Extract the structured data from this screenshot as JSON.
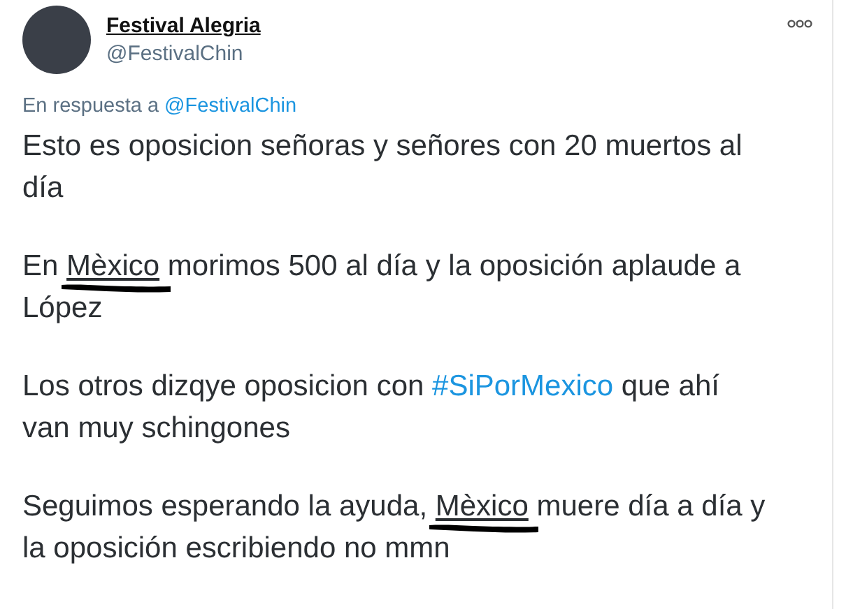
{
  "tweet": {
    "author": {
      "name": "Festival Alegria",
      "handle": "@FestivalChin"
    },
    "reply_to": {
      "label": "En respuesta a",
      "handle": "@FestivalChin"
    },
    "paragraphs": [
      [
        {
          "kind": "text",
          "text": "Esto es oposicion señoras y señores con 20 muertos al día"
        }
      ],
      [
        {
          "kind": "text",
          "text": "En "
        },
        {
          "kind": "marked",
          "text": "Mèxico"
        },
        {
          "kind": "text",
          "text": " morimos 500 al día y la oposición aplaude a López"
        }
      ],
      [
        {
          "kind": "text",
          "text": "Los otros dizqye oposicion con "
        },
        {
          "kind": "hashtag",
          "text": "#SiPorMexico"
        },
        {
          "kind": "text",
          "text": " que ahí van muy schingones"
        }
      ],
      [
        {
          "kind": "text",
          "text": "Seguimos esperando la ayuda, "
        },
        {
          "kind": "marked",
          "text": "Mèxico"
        },
        {
          "kind": "text",
          "text": " muere día a día y la oposición escribiendo no mmn"
        }
      ]
    ]
  }
}
